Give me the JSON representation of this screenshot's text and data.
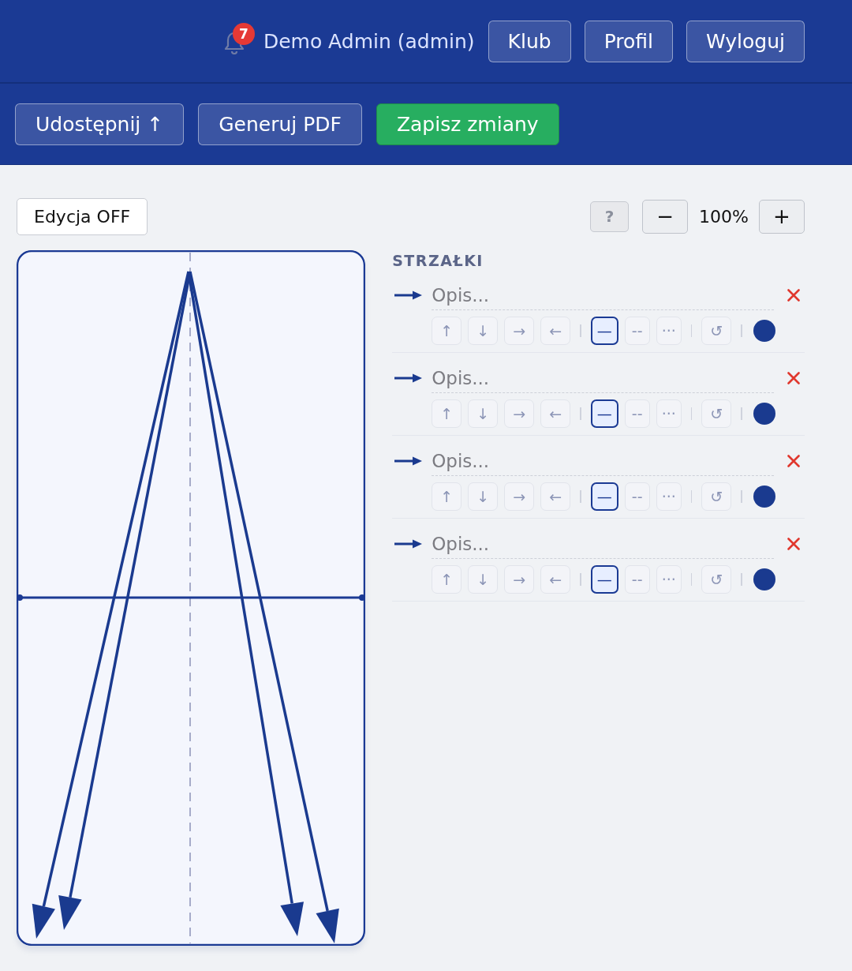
{
  "header": {
    "notification_count": "7",
    "user": "Demo Admin (admin)",
    "buttons": [
      "Klub",
      "Profil",
      "Wyloguj"
    ]
  },
  "toolbar": {
    "buttons": [
      {
        "label": "Udostępnij ↑",
        "kind": "default"
      },
      {
        "label": "Generuj PDF",
        "kind": "default"
      },
      {
        "label": "Zapisz zmiany",
        "kind": "primary"
      }
    ]
  },
  "editor": {
    "edit_toggle": {
      "label": "Edycja OFF",
      "on": false
    },
    "help_button": "?",
    "zoom": {
      "out_button": "−",
      "value": "100%",
      "in_button": "+"
    }
  },
  "arrows_panel": {
    "title": "STRZAŁKI",
    "arrows": [
      {
        "placeholder": "Opis...",
        "color": "#1a3a8f",
        "direction_buttons": [
          "↑",
          "↓",
          "→",
          "←"
        ],
        "line_styles": [
          {
            "label": "—",
            "selected": true
          },
          {
            "label": "--",
            "selected": false
          },
          {
            "label": "···",
            "selected": false
          }
        ],
        "reset_button": "↺"
      },
      {
        "placeholder": "Opis...",
        "color": "#1a3a8f",
        "direction_buttons": [
          "↑",
          "↓",
          "→",
          "←"
        ],
        "line_styles": [
          {
            "label": "—",
            "selected": true
          },
          {
            "label": "--",
            "selected": false
          },
          {
            "label": "···",
            "selected": false
          }
        ],
        "reset_button": "↺"
      },
      {
        "placeholder": "Opis...",
        "color": "#1a3a8f",
        "direction_buttons": [
          "↑",
          "↓",
          "→",
          "←"
        ],
        "line_styles": [
          {
            "label": "—",
            "selected": true
          },
          {
            "label": "--",
            "selected": false
          },
          {
            "label": "···",
            "selected": false
          }
        ],
        "reset_button": "↺"
      },
      {
        "placeholder": "Opis...",
        "color": "#1a3a8f",
        "direction_buttons": [
          "↑",
          "↓",
          "→",
          "←"
        ],
        "line_styles": [
          {
            "label": "—",
            "selected": true
          },
          {
            "label": "--",
            "selected": false
          },
          {
            "label": "···",
            "selected": false
          }
        ],
        "reset_button": "↺"
      }
    ]
  }
}
